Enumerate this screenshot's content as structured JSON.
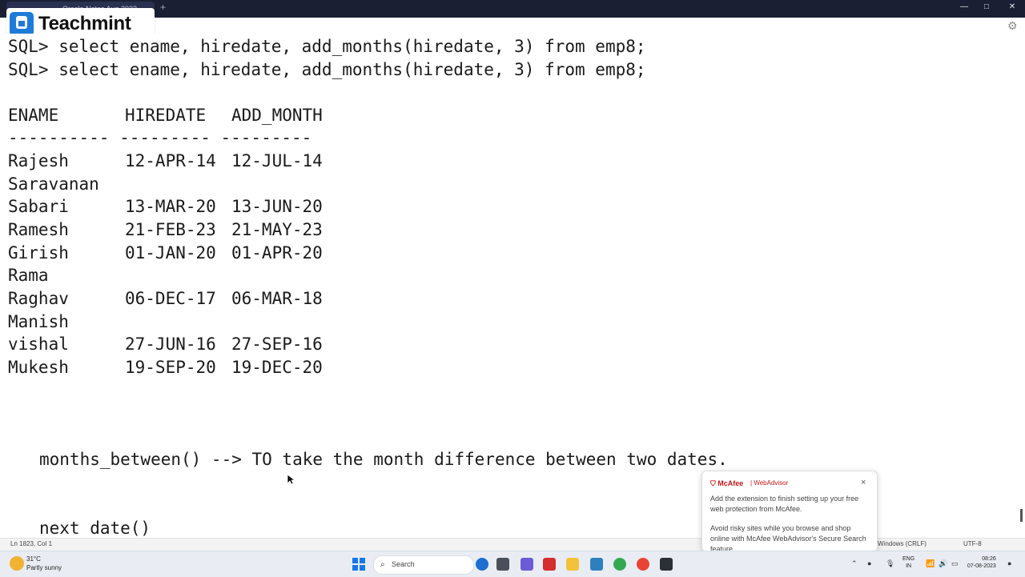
{
  "window": {
    "tab_title": "Oracle Notes Aug 2023",
    "new_tab_symbol": "+",
    "minimize": "—",
    "maximize": "□",
    "close": "✕"
  },
  "watermark": {
    "logo_text": "Teachmint"
  },
  "terminal": {
    "command_lines": [
      "SQL> select ename, hiredate, add_months(hiredate, 3) from emp8;",
      "SQL> select ename, hiredate, add_months(hiredate, 3) from emp8;"
    ],
    "table": {
      "headers": [
        "ENAME",
        "HIREDATE",
        "ADD_MONTH"
      ],
      "separator": "---------- --------- ---------",
      "rows": [
        [
          "Rajesh",
          "12-APR-14",
          "12-JUL-14"
        ],
        [
          "Saravanan",
          "",
          ""
        ],
        [
          "Sabari",
          "13-MAR-20",
          "13-JUN-20"
        ],
        [
          "Ramesh",
          "21-FEB-23",
          "21-MAY-23"
        ],
        [
          "Girish",
          "01-JAN-20",
          "01-APR-20"
        ],
        [
          "Rama",
          "",
          ""
        ],
        [
          "Raghav",
          "06-DEC-17",
          "06-MAR-18"
        ],
        [
          "Manish",
          "",
          ""
        ],
        [
          "vishal",
          "27-JUN-16",
          "27-SEP-16"
        ],
        [
          "Mukesh",
          "19-SEP-20",
          "19-DEC-20"
        ]
      ]
    },
    "note_lines": [
      "months_between() --> TO take the month difference between two dates.",
      "next date()"
    ]
  },
  "statusbar": {
    "position": "Ln 1823, Col 1",
    "line_ending": "Windows (CRLF)",
    "encoding": "UTF-8"
  },
  "mcafee_popup": {
    "brand": "McAfee",
    "product": "WebAdvisor",
    "message1": "Add the extension to finish setting up your free web protection from McAfee.",
    "message2": "Avoid risky sites while you browse and shop online with McAfee WebAdvisor's Secure Search feature.",
    "close_icon": "×"
  },
  "taskbar": {
    "weather_temp": "31°C",
    "weather_desc": "Partly sunny",
    "search_placeholder": "Search",
    "lang_primary": "ENG",
    "lang_secondary": "IN",
    "time": "08:26",
    "date": "07-08-2023",
    "accent_color": "#1877e8"
  }
}
